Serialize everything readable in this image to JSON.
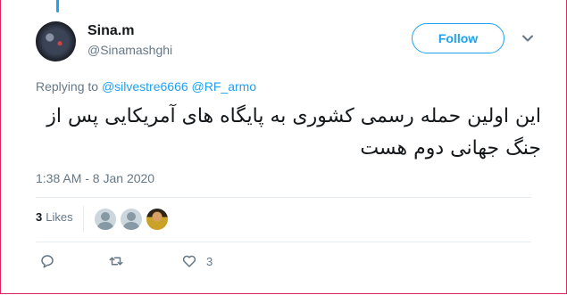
{
  "author": {
    "name": "Sina.m",
    "handle": "@Sinamashghi"
  },
  "follow_label": "Follow",
  "reply_context": {
    "prefix": "Replying to",
    "mentions": [
      "@silvestre6666",
      "@RF_armo"
    ]
  },
  "tweet": {
    "text": "این اولین حمله رسمی کشوری به پایگاه های آمریکایی پس از جنگ جهانی دوم هست",
    "timestamp": "1:38 AM - 8 Jan 2020"
  },
  "stats": {
    "likes_count": "3",
    "likes_label": "Likes"
  },
  "actions": {
    "reply_count": "",
    "retweet_count": "",
    "like_count": "3"
  },
  "icons": [
    "chevron-down-icon",
    "reply-icon",
    "retweet-icon",
    "heart-icon"
  ],
  "colors": {
    "accent": "#1da1f2",
    "muted": "#657786",
    "frame_border": "#e0245e"
  }
}
